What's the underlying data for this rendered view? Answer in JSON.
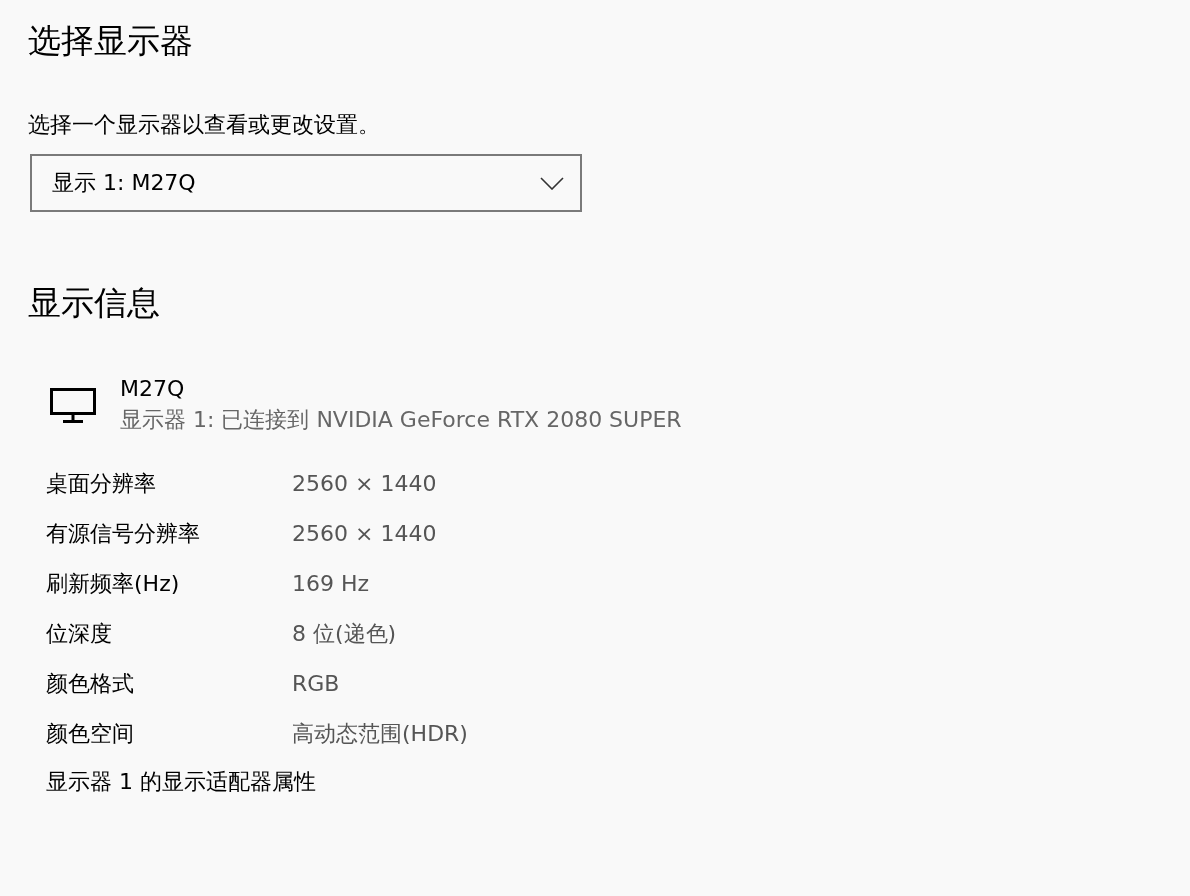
{
  "title": "选择显示器",
  "subtitle": "选择一个显示器以查看或更改设置。",
  "display_select": {
    "value": "显示 1: M27Q"
  },
  "section_title": "显示信息",
  "monitor": {
    "name": "M27Q",
    "description": "显示器 1: 已连接到 NVIDIA GeForce RTX 2080 SUPER"
  },
  "properties": [
    {
      "label": "桌面分辨率",
      "value": "2560 × 1440"
    },
    {
      "label": "有源信号分辨率",
      "value": "2560 × 1440"
    },
    {
      "label": "刷新频率(Hz)",
      "value": "169 Hz"
    },
    {
      "label": "位深度",
      "value": "8 位(递色)"
    },
    {
      "label": "颜色格式",
      "value": "RGB"
    },
    {
      "label": "颜色空间",
      "value": "高动态范围(HDR)"
    }
  ],
  "adapter_link": "显示器 1 的显示适配器属性"
}
